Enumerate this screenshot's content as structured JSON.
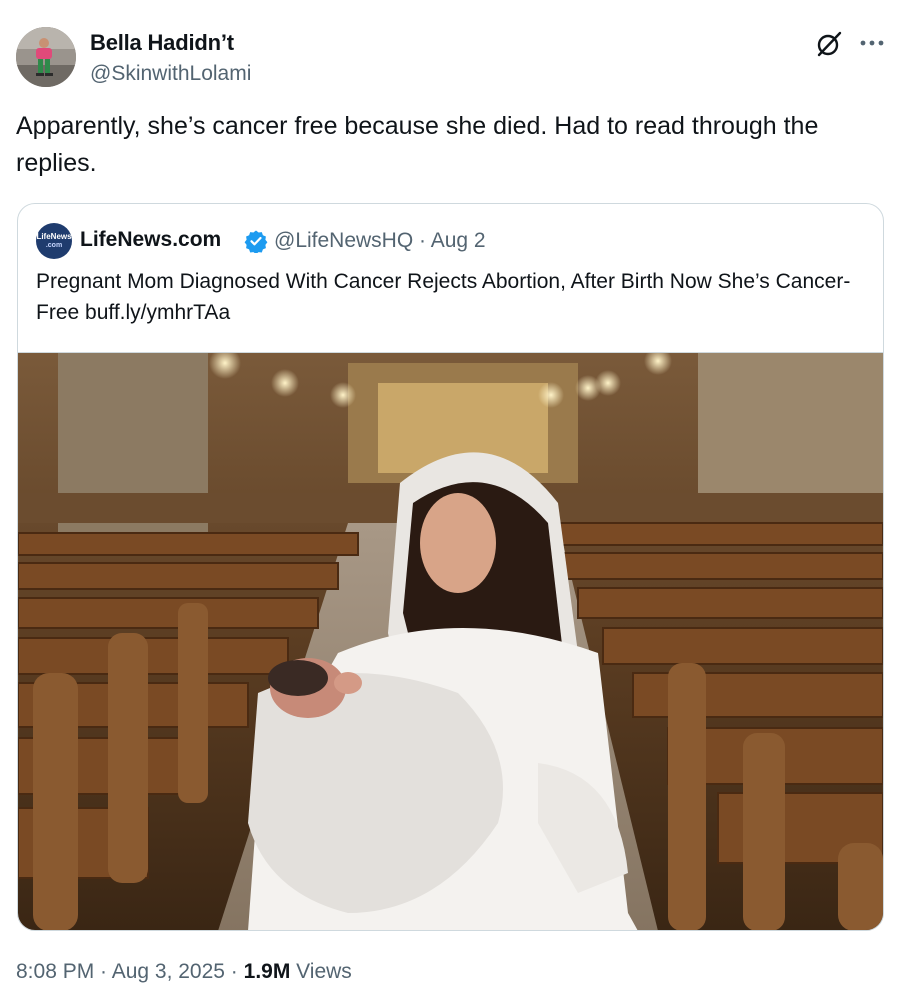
{
  "author": {
    "name": "Bella Hadidn’t",
    "handle": "@SkinwithLolami"
  },
  "icons": {
    "grok": "grok-slash-icon",
    "more": "more-horizontal-icon",
    "verified": "verified-badge-icon"
  },
  "tweet": {
    "text": "Apparently, she’s cancer free because she died. Had to read through the replies."
  },
  "quote": {
    "logo_line1": "LifeNews",
    "logo_line2": ".com",
    "name": "LifeNews.com",
    "handle_date": "@LifeNewsHQ · Aug 2",
    "text": "Pregnant Mom Diagnosed With Cancer Rejects Abortion, After Birth Now She’s Cancer-Free buff.ly/ymhrTAa"
  },
  "footer": {
    "time": "8:08 PM · Aug 3, 2025 · ",
    "views_count": "1.9M",
    "views_label": " Views"
  },
  "colors": {
    "text": "#0f1419",
    "secondary": "#536471",
    "border": "#cfd9de",
    "verified": "#1d9bf0"
  }
}
